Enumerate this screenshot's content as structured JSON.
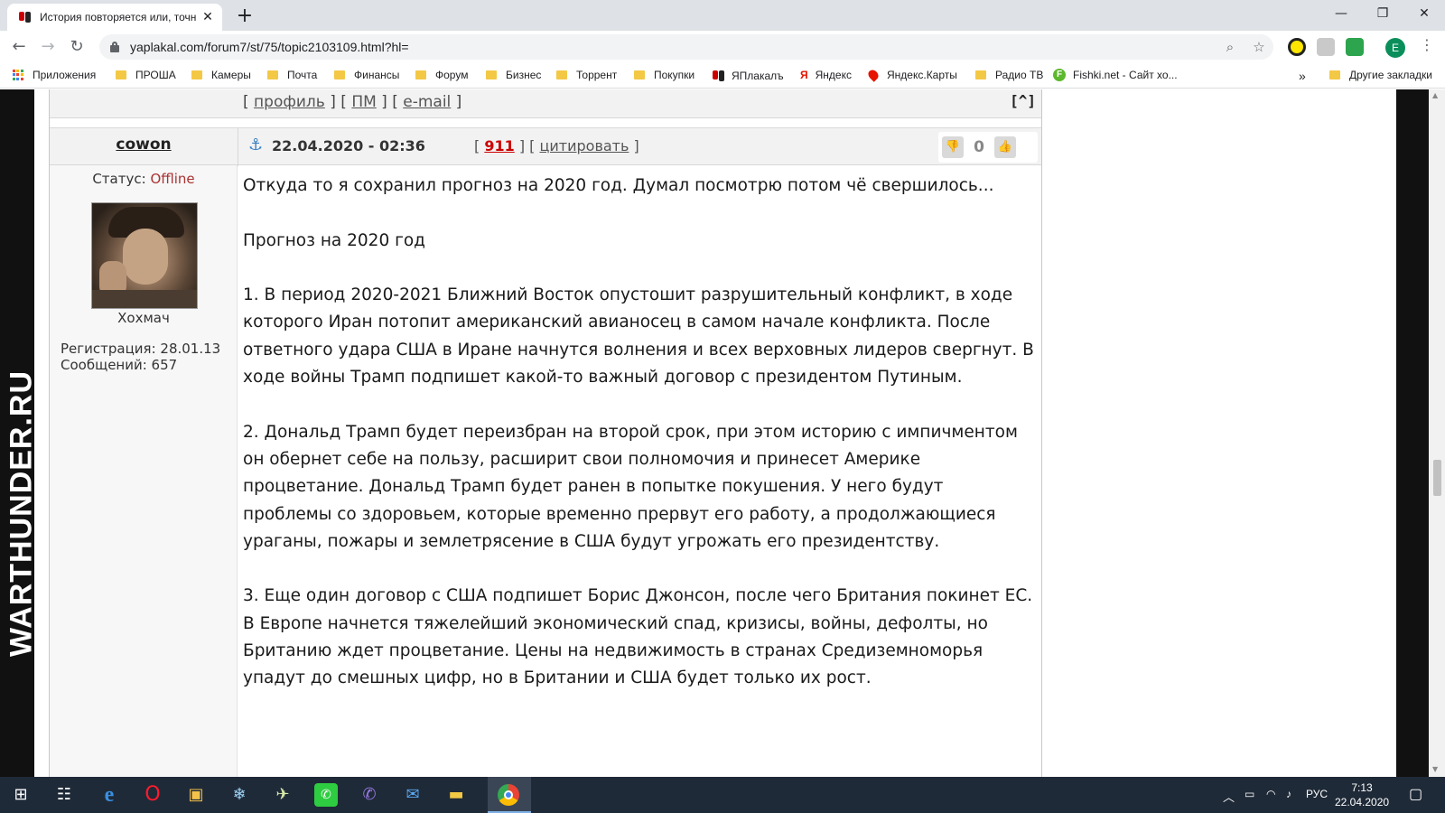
{
  "browser": {
    "tab_title": "История повторяется или, точн",
    "tab_close": "✕",
    "new_tab": "+",
    "window_controls": {
      "minimize": "—",
      "restore": "❐",
      "close": "✕"
    },
    "nav": {
      "back": "←",
      "forward": "→",
      "reload": "↻"
    },
    "url": "yaplakal.com/forum7/st/75/topic2103109.html?hl=",
    "zoom_icon": "⌕",
    "star_icon": "☆",
    "profile_initial": "E",
    "menu": "⋮"
  },
  "bookmarks": {
    "items": [
      "Приложения",
      "ПРОША",
      "Камеры",
      "Почта",
      "Финансы",
      "Форум",
      "Бизнес",
      "Торрент",
      "Покупки",
      "ЯПлакалъ",
      "Яндекс",
      "Яндекс.Карты",
      "Радио ТВ",
      "Fishki.net - Сайт хо..."
    ],
    "overflow": "»",
    "other": "Другие закладки"
  },
  "side_banner": "WARTHUNDER.RU",
  "forum": {
    "profile_bar": {
      "profile": "профиль",
      "pm": "ПМ",
      "email": "e-mail",
      "to_top": "[^]"
    },
    "post": {
      "author": "cowon",
      "date": "22.04.2020 - 02:36",
      "post_number": "911",
      "quote": "цитировать",
      "score": "0",
      "status_label": "Статус:",
      "status_value": "Offline",
      "rank": "Хохмач",
      "registration": "Регистрация: 28.01.13",
      "messages": "Сообщений: 657",
      "body": [
        "Откуда то я сохранил прогноз на 2020 год. Думал посмотрю потом чё свершилось...",
        "Прогноз на 2020 год",
        "1. В период 2020-2021 Ближний Восток опустошит разрушительный конфликт, в ходе которого Иран потопит американский авианосец в самом начале конфликта. После ответного удара США в Иране начнутся волнения и всех верховных лидеров свергнут. В ходе войны Трамп подпишет какой-то важный договор с президентом Путиным.",
        "2. Дональд Трамп будет переизбран на второй срок, при этом историю с импичментом он обернет себе на пользу, расширит свои полномочия и принесет Америке процветание. Дональд Трамп будет ранен в попытке покушения. У него будут проблемы со здоровьем, которые временно прервут его работу, а продолжающиеся ураганы, пожары и землетрясение в США будут угрожать его президентству.",
        "3. Еще один договор с США подпишет Борис Джонсон, после чего Британия покинет ЕС. В Европе начнется тяжелейший экономический спад, кризисы, войны, дефолты, но Британию ждет процветание. Цены на недвижимость в странах Средиземноморья упадут до смешных цифр, но в Британии и США будет только их рост."
      ]
    }
  },
  "taskbar": {
    "language": "РУС",
    "time": "7:13",
    "date": "22.04.2020"
  },
  "colors": {
    "accent_link": "#c00000",
    "taskbar": "#1f2a38",
    "offline": "#aa3333"
  }
}
